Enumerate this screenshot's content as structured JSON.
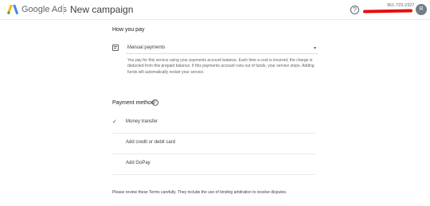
{
  "header": {
    "brand": "Google Ads",
    "page_title": "New campaign",
    "help_icon": "help-circle-icon",
    "account_id": "951-723-2327",
    "avatar_initial": "R",
    "colors": {
      "logo_blue": "#4285f4",
      "logo_yellow": "#fbbc04",
      "logo_green": "#34a853",
      "redaction": "#e50f0f",
      "avatar_bg": "#6f7f86"
    }
  },
  "how_you_pay": {
    "title": "How you pay",
    "icon": "calendar-icon",
    "selected": "Manual payments",
    "description": "You pay for this service using your payments account balance. Each time a cost is incurred, the charge is deducted from this prepaid balance. If this payments account runs out of funds, your service stops. Adding funds will automatically restart your service."
  },
  "payment_method": {
    "title": "Payment method",
    "help_icon": "help-circle-icon",
    "items": [
      {
        "label": "Money transfer",
        "selected": true
      },
      {
        "label": "Add credit or debit card",
        "selected": false
      },
      {
        "label": "Add GoPay",
        "selected": false
      }
    ]
  },
  "terms_text": "Please review these Terms carefully. They include the use of binding arbitration to resolve disputes."
}
